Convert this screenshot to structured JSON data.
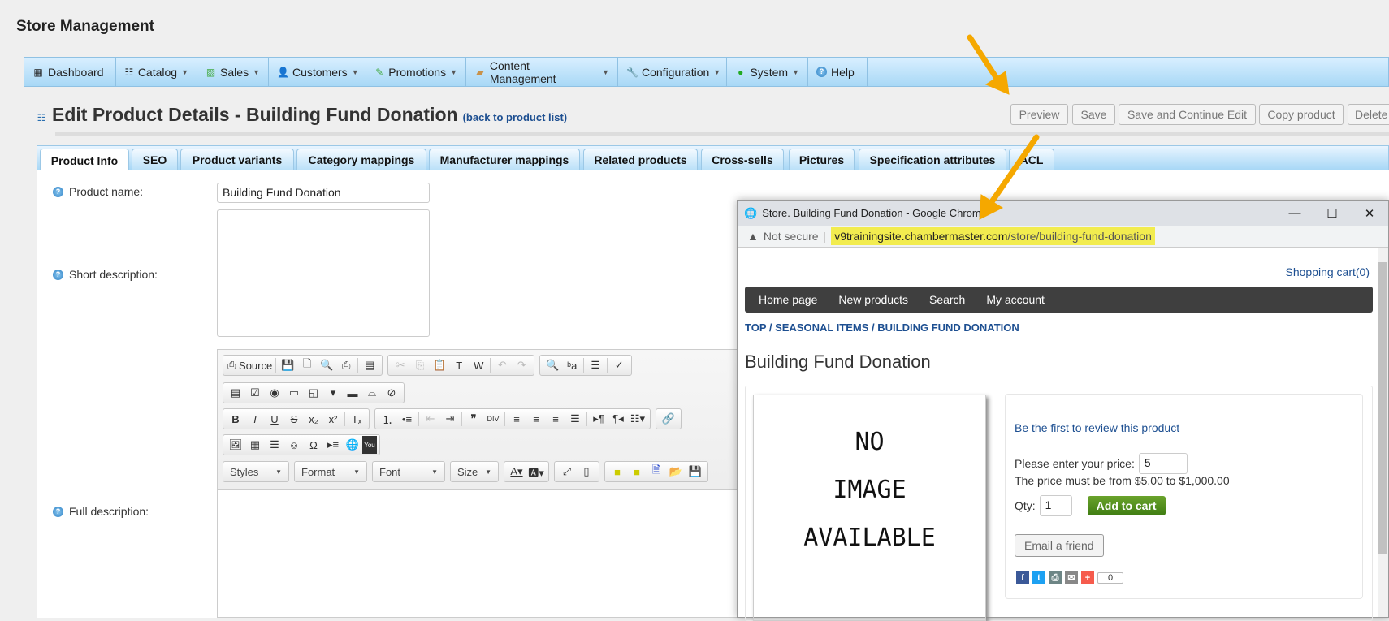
{
  "app_title": "Store Management",
  "menu": [
    {
      "label": "Dashboard",
      "icon": "dashboard-icon"
    },
    {
      "label": "Catalog",
      "icon": "catalog-icon"
    },
    {
      "label": "Sales",
      "icon": "sales-icon"
    },
    {
      "label": "Customers",
      "icon": "customers-icon"
    },
    {
      "label": "Promotions",
      "icon": "promotions-icon"
    },
    {
      "label": "Content Management",
      "icon": "folder-icon"
    },
    {
      "label": "Configuration",
      "icon": "wrench-icon"
    },
    {
      "label": "System",
      "icon": "system-icon"
    },
    {
      "label": "Help",
      "icon": "help-icon"
    }
  ],
  "page": {
    "title": "Edit Product Details - Building Fund Donation",
    "back_link": "(back to product list)"
  },
  "actions": {
    "preview": "Preview",
    "save": "Save",
    "save_continue": "Save and Continue Edit",
    "copy": "Copy product",
    "delete": "Delete"
  },
  "tabs": [
    "Product Info",
    "SEO",
    "Product variants",
    "Category mappings",
    "Manufacturer mappings",
    "Related products",
    "Cross-sells",
    "Pictures",
    "Specification attributes",
    "ACL"
  ],
  "form": {
    "product_name_label": "Product name:",
    "product_name_value": "Building Fund Donation",
    "short_desc_label": "Short description:",
    "full_desc_label": "Full description:"
  },
  "editor": {
    "source": "Source",
    "styles": "Styles",
    "format": "Format",
    "font": "Font",
    "size": "Size"
  },
  "popup": {
    "window_title": "Store. Building Fund Donation - Google Chrome",
    "not_secure": "Not secure",
    "url_host": "v9trainingsite.chambermaster.com",
    "url_path": "/store/building-fund-donation",
    "shopping_cart": "Shopping cart(0)",
    "nav": [
      "Home page",
      "New products",
      "Search",
      "My account"
    ],
    "breadcrumb": "TOP / SEASONAL ITEMS / BUILDING FUND DONATION",
    "product_title": "Building Fund Donation",
    "no_image": [
      "NO",
      "IMAGE",
      "AVAILABLE"
    ],
    "review": "Be the first to review this product",
    "price_label": "Please enter your price:",
    "price_value": "5",
    "price_range": "The price must be from $5.00 to $1,000.00",
    "qty_label": "Qty:",
    "qty_value": "1",
    "add_to_cart": "Add to cart",
    "email_friend": "Email a friend",
    "share_count": "0"
  },
  "colors": {
    "arrow": "#f5a800",
    "menu": "#a8d8f6",
    "url_highlight": "#f2ec4f",
    "add_to_cart": "#4f8f1c"
  }
}
